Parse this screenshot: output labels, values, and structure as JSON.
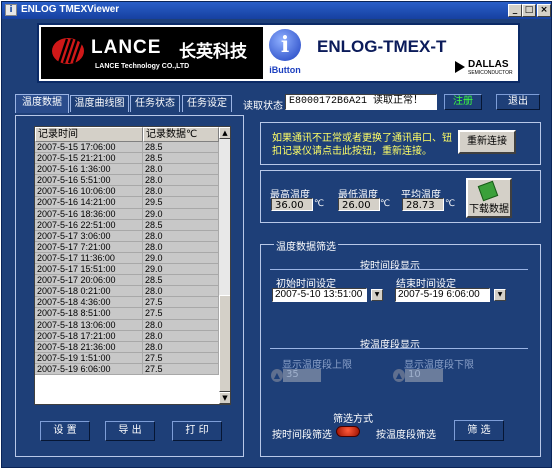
{
  "window": {
    "title": "ENLOG TMEXViewer",
    "controls": [
      "_",
      "□",
      "×"
    ]
  },
  "banner": {
    "brand": "LANCE",
    "brand_cn": "长英科技",
    "brand_sub": "LANCE  Technology CO.,LTD",
    "ibutton_label": "iButton",
    "product": "ENLOG-TMEX-T",
    "partner": "DALLAS",
    "partner_sub": "SEMICONDUCTOR"
  },
  "tabs": [
    "温度数据",
    "温度曲线图",
    "任务状态",
    "任务设定"
  ],
  "read_status": {
    "label": "读取状态",
    "value": "E8000172B6A21 读取正常！"
  },
  "header_buttons": {
    "register": "注册",
    "exit": "退出"
  },
  "table": {
    "columns": [
      "记录时间",
      "记录数据℃"
    ],
    "rows": [
      [
        "2007-5-15 17:06:00",
        "28.5"
      ],
      [
        "2007-5-15 21:21:00",
        "28.5"
      ],
      [
        "2007-5-16 1:36:00",
        "28.0"
      ],
      [
        "2007-5-16 5:51:00",
        "28.0"
      ],
      [
        "2007-5-16 10:06:00",
        "28.0"
      ],
      [
        "2007-5-16 14:21:00",
        "29.5"
      ],
      [
        "2007-5-16 18:36:00",
        "29.0"
      ],
      [
        "2007-5-16 22:51:00",
        "28.5"
      ],
      [
        "2007-5-17 3:06:00",
        "28.0"
      ],
      [
        "2007-5-17 7:21:00",
        "28.0"
      ],
      [
        "2007-5-17 11:36:00",
        "29.0"
      ],
      [
        "2007-5-17 15:51:00",
        "29.0"
      ],
      [
        "2007-5-17 20:06:00",
        "28.5"
      ],
      [
        "2007-5-18 0:21:00",
        "28.0"
      ],
      [
        "2007-5-18 4:36:00",
        "27.5"
      ],
      [
        "2007-5-18 8:51:00",
        "27.5"
      ],
      [
        "2007-5-18 13:06:00",
        "28.0"
      ],
      [
        "2007-5-18 17:21:00",
        "28.0"
      ],
      [
        "2007-5-18 21:36:00",
        "28.0"
      ],
      [
        "2007-5-19 1:51:00",
        "27.5"
      ],
      [
        "2007-5-19 6:06:00",
        "27.5"
      ]
    ]
  },
  "bottom_buttons": {
    "settings": "设 置",
    "export": "导 出",
    "print": "打 印"
  },
  "reconnect": {
    "notice": "如果通讯不正常或者更换了通讯串口、钮扣记录仪请点击此按钮，重新连接。",
    "button": "重新连接"
  },
  "stats": {
    "max_label": "最高温度",
    "max_value": "36.00",
    "min_label": "最低温度",
    "min_value": "26.00",
    "avg_label": "平均温度",
    "avg_value": "28.73",
    "unit": "℃",
    "download": "下载数据"
  },
  "filter": {
    "title": "温度数据筛选",
    "by_time_title": "按时间段显示",
    "start_label": "初始时间设定",
    "start_value": "2007-5-10 13:51:00",
    "end_label": "结束时间设定",
    "end_value": "2007-5-19 6:06:00",
    "by_temp_title": "按温度段显示",
    "upper_label": "显示温度段上限",
    "upper_value": "35",
    "lower_label": "显示温度段下限",
    "lower_value": "10",
    "mode_label": "筛选方式",
    "mode_time": "按时间段筛选",
    "mode_temp": "按温度段筛选",
    "filter_button": "筛 选"
  }
}
